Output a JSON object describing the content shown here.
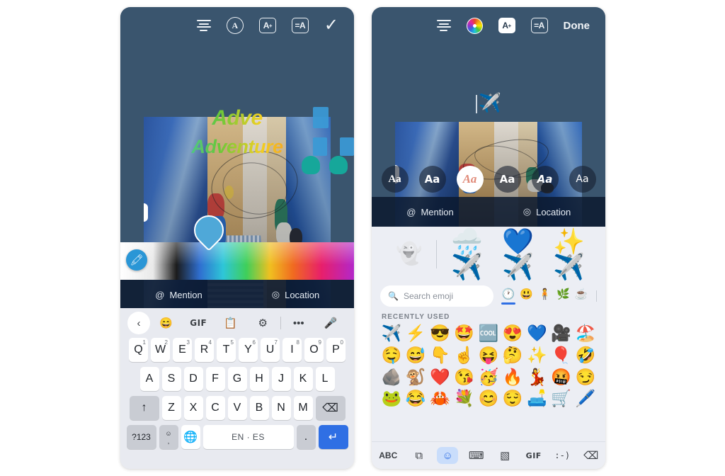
{
  "left_phone": {
    "toolbar": {
      "align_icon": "text-align-icon",
      "circle_a_label": "A",
      "size_label": "A",
      "size_sup": "+",
      "spacing_label": "=A",
      "confirm_label": "✓"
    },
    "canvas": {
      "headline_1": "Adve",
      "headline_2": "Adventure"
    },
    "color_picker": {
      "eyedropper_icon": "eyedropper-icon",
      "marker_color": "#4fa8d8"
    },
    "action_bar": {
      "mention_icon": "@",
      "mention_label": "Mention",
      "location_icon": "◎",
      "location_label": "Location"
    },
    "keyboard": {
      "tools": [
        {
          "name": "back-chevron-icon",
          "glyph": "‹"
        },
        {
          "name": "sticker-icon",
          "glyph": "☺"
        },
        {
          "name": "gif-icon",
          "glyph": "GIF"
        },
        {
          "name": "clipboard-icon",
          "glyph": "Ὄb"
        },
        {
          "name": "settings-gear-icon",
          "glyph": "⚙"
        },
        {
          "name": "more-options-icon",
          "glyph": "•••"
        },
        {
          "name": "microphone-icon",
          "glyph": "Ἲ4"
        }
      ],
      "row1": [
        {
          "key": "Q",
          "num": "1"
        },
        {
          "key": "W",
          "num": "2"
        },
        {
          "key": "E",
          "num": "3"
        },
        {
          "key": "R",
          "num": "4"
        },
        {
          "key": "T",
          "num": "5"
        },
        {
          "key": "Y",
          "num": "6"
        },
        {
          "key": "U",
          "num": "7"
        },
        {
          "key": "I",
          "num": "8"
        },
        {
          "key": "O",
          "num": "9"
        },
        {
          "key": "P",
          "num": "0"
        }
      ],
      "row2": [
        "A",
        "S",
        "D",
        "F",
        "G",
        "H",
        "J",
        "K",
        "L"
      ],
      "row3": {
        "shift": "↑",
        "letters": [
          "Z",
          "X",
          "C",
          "V",
          "B",
          "N",
          "M"
        ],
        "backspace": "⌫"
      },
      "row4": {
        "symbols": "?123",
        "emoji_comma_top": "☺",
        "emoji_comma_bottom": ",",
        "globe": "⊕",
        "space_label": "EN · ES",
        "period": ".",
        "enter": "↵"
      }
    }
  },
  "right_phone": {
    "toolbar": {
      "align_icon": "text-align-icon",
      "color_wheel_icon": "color-wheel-icon",
      "size_label": "A",
      "size_sup": "+",
      "spacing_label": "=A",
      "done_label": "Done"
    },
    "canvas": {
      "typed_emoji": "✈️"
    },
    "font_picker": [
      {
        "label": "Aa",
        "style": "serif",
        "selected": false
      },
      {
        "label": "Aa",
        "style": "bold",
        "selected": false
      },
      {
        "label": "Aa",
        "style": "script",
        "selected": true
      },
      {
        "label": "Aa",
        "style": "bold-2",
        "selected": false
      },
      {
        "label": "Aa",
        "style": "italic-bold",
        "selected": false
      },
      {
        "label": "Aa",
        "style": "light",
        "selected": false
      }
    ],
    "action_bar": {
      "mention_icon": "@",
      "mention_label": "Mention",
      "location_icon": "◎",
      "location_label": "Location"
    },
    "emoji_panel": {
      "suggestions": [
        "👻",
        "🌧️✈️",
        "💙✈️",
        "✨✈️"
      ],
      "search_placeholder": "Search emoji",
      "search_icon": "search-icon",
      "categories": [
        {
          "name": "recent-category",
          "glyph": "🕐",
          "selected": true
        },
        {
          "name": "smileys-category",
          "glyph": "😃",
          "selected": false
        },
        {
          "name": "people-category",
          "glyph": "🧍",
          "selected": false
        },
        {
          "name": "nature-category",
          "glyph": "🌿",
          "selected": false
        },
        {
          "name": "food-category",
          "glyph": "☕",
          "selected": false
        }
      ],
      "section_label": "RECENTLY USED",
      "rows": [
        [
          "✈️",
          "⚡",
          "😎",
          "🤩",
          "🆒",
          "😍",
          "💙",
          "🎥",
          "🏖️"
        ],
        [
          "🤤",
          "😅",
          "👇",
          "☝️",
          "😝",
          "🤔",
          "✨",
          "🎈",
          "🤣"
        ],
        [
          "🪨",
          "🐒",
          "❤️",
          "😘",
          "🥳",
          "🔥",
          "💃",
          "🤬",
          "😏"
        ],
        [
          "🐸",
          "😂",
          "🦀",
          "💐",
          "😊",
          "😌",
          "🛋️",
          "🛒",
          "🖊️"
        ]
      ],
      "bottom_bar": [
        {
          "name": "abc-keyboard-button",
          "glyph": "ABC",
          "selected": false
        },
        {
          "name": "image-search-button",
          "glyph": "⧉",
          "selected": false
        },
        {
          "name": "emoji-button",
          "glyph": "☺",
          "selected": true
        },
        {
          "name": "sticker-button",
          "glyph": "⌨",
          "selected": false
        },
        {
          "name": "sticker-alt-button",
          "glyph": "▧",
          "selected": false
        },
        {
          "name": "gif-button",
          "glyph": "GIF",
          "selected": false
        },
        {
          "name": "emoticon-button",
          "glyph": ":-)",
          "selected": false
        },
        {
          "name": "backspace-button",
          "glyph": "⌫",
          "selected": false
        }
      ]
    }
  }
}
